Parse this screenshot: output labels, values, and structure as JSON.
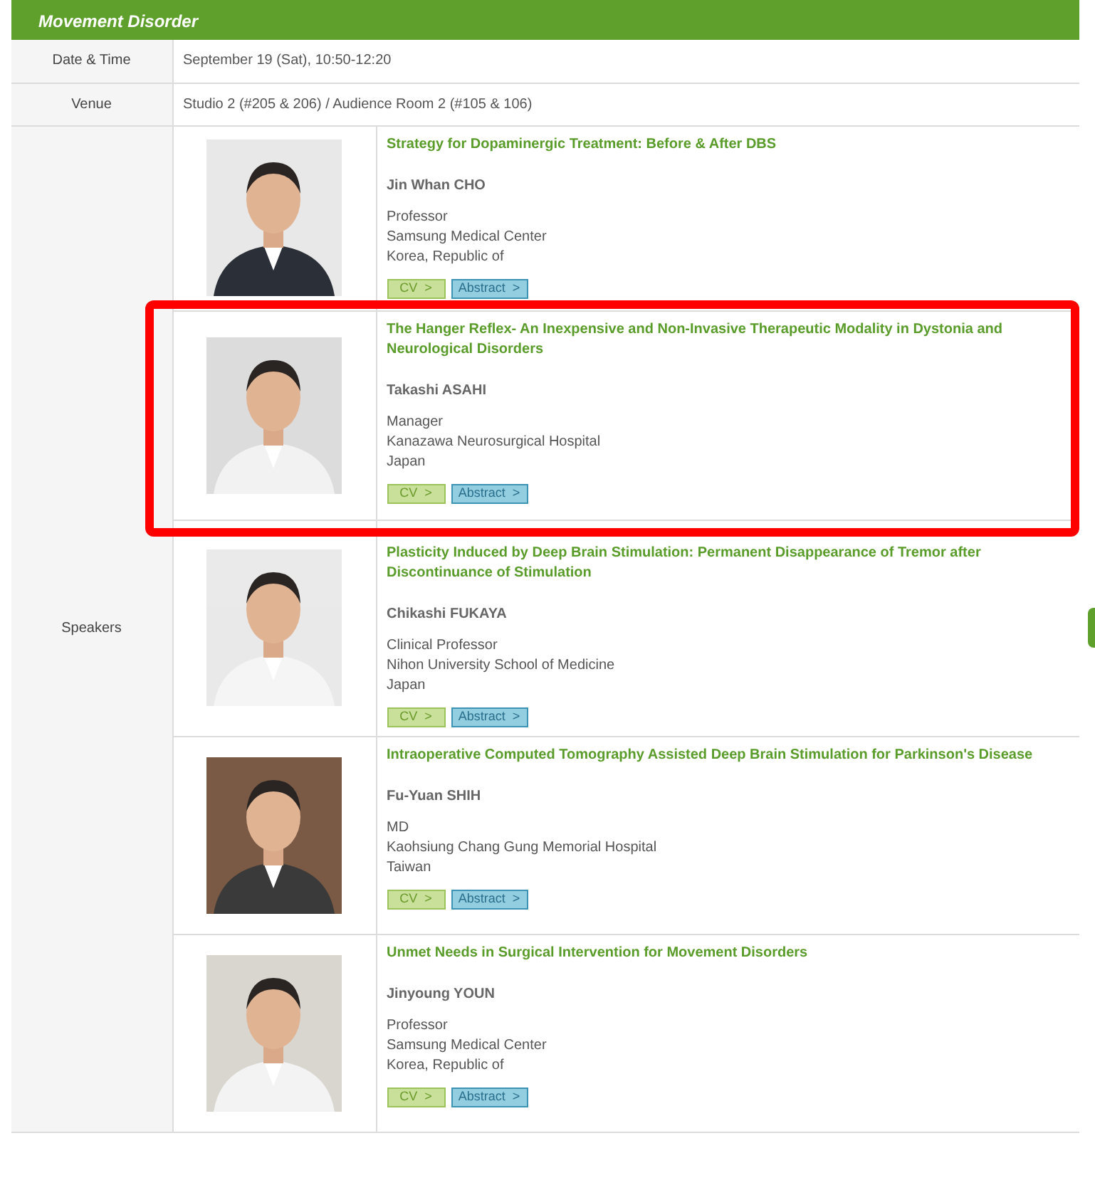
{
  "session": {
    "title": "Movement Disorder"
  },
  "info": [
    {
      "label": "Date & Time",
      "value": "September 19 (Sat), 10:50-12:20"
    },
    {
      "label": "Venue",
      "value": "Studio 2 (#205 & 206) / Audience Room 2 (#105 & 106)"
    }
  ],
  "speakers_label": "Speakers",
  "speakers": [
    {
      "title": "Strategy for Dopaminergic Treatment: Before & After DBS",
      "name": "Jin Whan CHO",
      "position": "Professor",
      "affiliation": "Samsung Medical Center",
      "country": "Korea, Republic of",
      "buttons": [
        "CV  >",
        "Abstract  >"
      ]
    },
    {
      "title": "The Hanger Reflex- An Inexpensive and Non-Invasive Therapeutic Modality in Dystonia and Neurological Disorders",
      "name": "Takashi ASAHI",
      "position": "Manager",
      "affiliation": "Kanazawa Neurosurgical Hospital",
      "country": "Japan",
      "buttons": [
        "CV  >",
        "Abstract  >"
      ]
    },
    {
      "title": "Plasticity Induced by Deep Brain Stimulation: Permanent Disappearance of Tremor after Discontinuance of Stimulation",
      "name": "Chikashi FUKAYA",
      "position": "Clinical Professor",
      "affiliation": "Nihon University School of Medicine",
      "country": "Japan",
      "buttons": [
        "CV  >",
        "Abstract  >"
      ]
    },
    {
      "title": "Intraoperative Computed Tomography Assisted Deep Brain Stimulation for Parkinson's Disease",
      "name": "Fu-Yuan SHIH",
      "position": "MD",
      "affiliation": "Kaohsiung Chang Gung Memorial Hospital",
      "country": "Taiwan",
      "buttons": [
        "CV  >",
        "Abstract  >"
      ]
    },
    {
      "title": "Unmet Needs in Surgical Intervention for Movement Disorders",
      "name": "Jinyoung YOUN",
      "position": "Professor",
      "affiliation": "Samsung Medical Center",
      "country": "Korea, Republic of",
      "buttons": [
        "CV  >",
        "Abstract  >"
      ]
    }
  ]
}
